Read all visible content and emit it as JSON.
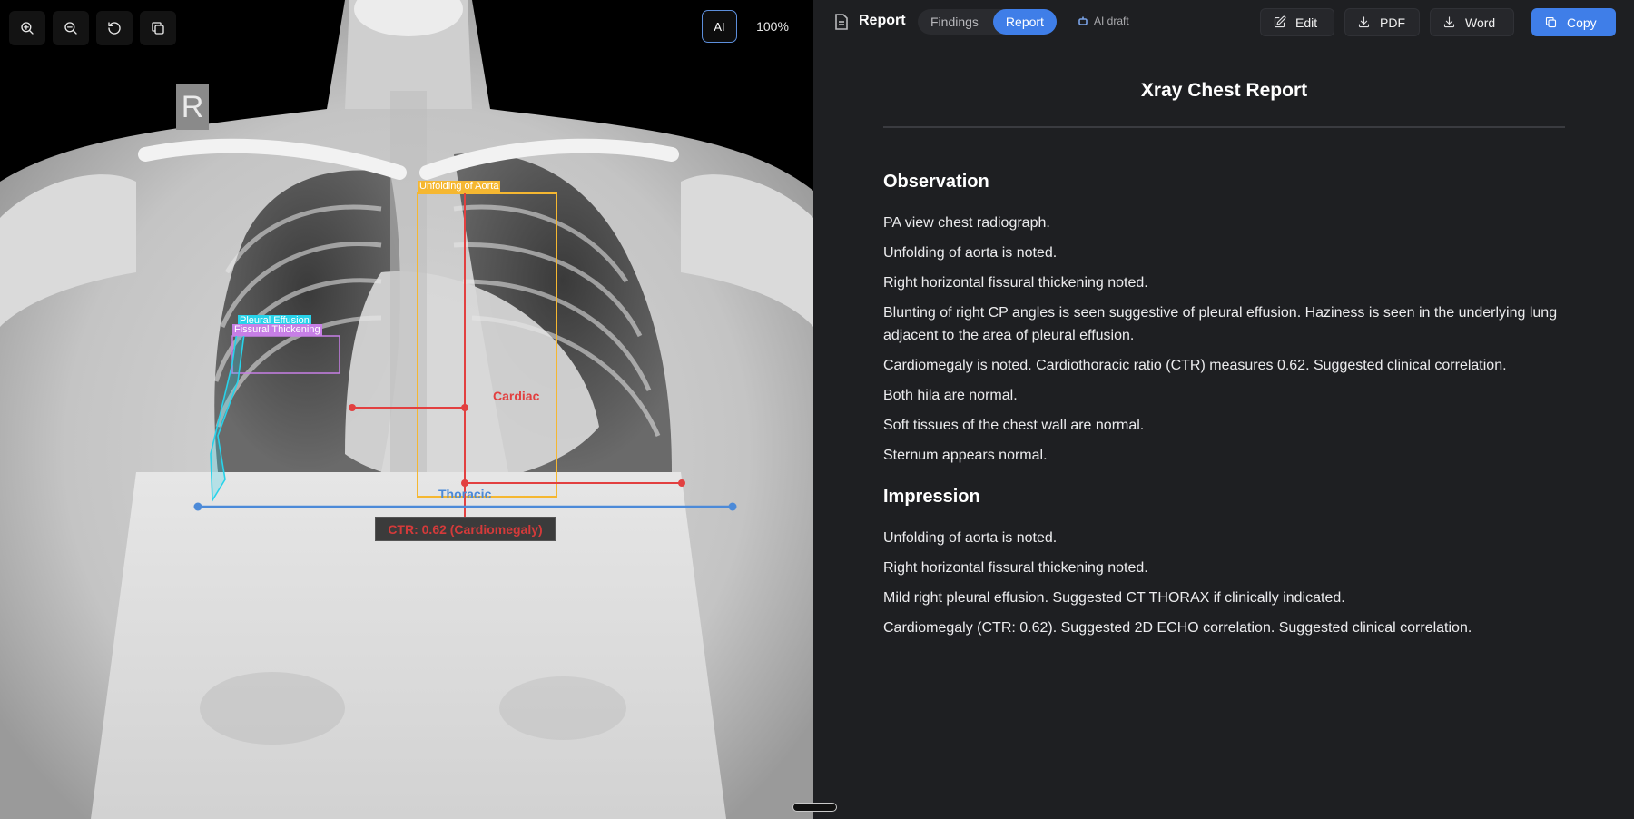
{
  "viewer": {
    "toolbar": [
      {
        "icon": "zoom-in-icon",
        "label": "Zoom in"
      },
      {
        "icon": "zoom-out-icon",
        "label": "Zoom out"
      },
      {
        "icon": "rotate-icon",
        "label": "Rotate"
      },
      {
        "icon": "copy-icon",
        "label": "Copy"
      }
    ],
    "ai_toggle_label": "AI",
    "zoom_level": "100%",
    "side_marker": "R",
    "annotations": {
      "aorta": "Unfolding of Aorta",
      "effusion": "Pleural Effusion",
      "fissural": "Fissural Thickening",
      "cardiac": "Cardiac",
      "thoracic": "Thoracic",
      "ctr": "CTR: 0.62 (Cardiomegaly)"
    },
    "colors": {
      "aorta_box": "#f5b731",
      "effusion": "#27d3ea",
      "fissural": "#c77fe6",
      "cardiac_line": "#e24040",
      "thoracic_line": "#4c8ad8"
    }
  },
  "panel": {
    "title": "Report",
    "tabs": [
      {
        "label": "Findings",
        "active": false
      },
      {
        "label": "Report",
        "active": true
      }
    ],
    "ai_draft_label": "AI draft",
    "buttons": {
      "edit": "Edit",
      "pdf": "PDF",
      "word": "Word",
      "copy": "Copy"
    },
    "accent_color": "#3f7ee8"
  },
  "report": {
    "title": "Xray Chest Report",
    "observation_heading": "Observation",
    "observation": [
      "PA view chest radiograph.",
      "Unfolding of aorta is noted.",
      "Right horizontal fissural thickening noted.",
      "Blunting of right CP angles is seen suggestive of pleural effusion. Haziness is seen in the underlying lung adjacent to the area of pleural effusion.",
      "Cardiomegaly is noted. Cardiothoracic ratio (CTR) measures 0.62. Suggested clinical correlation.",
      "Both hila are normal.",
      "Soft tissues of the chest wall are normal.",
      "Sternum appears normal."
    ],
    "impression_heading": "Impression",
    "impression": [
      "Unfolding of aorta is noted.",
      "Right horizontal fissural thickening noted.",
      "Mild right pleural effusion. Suggested CT THORAX if clinically indicated.",
      "Cardiomegaly (CTR: 0.62). Suggested 2D ECHO correlation. Suggested clinical correlation."
    ]
  }
}
